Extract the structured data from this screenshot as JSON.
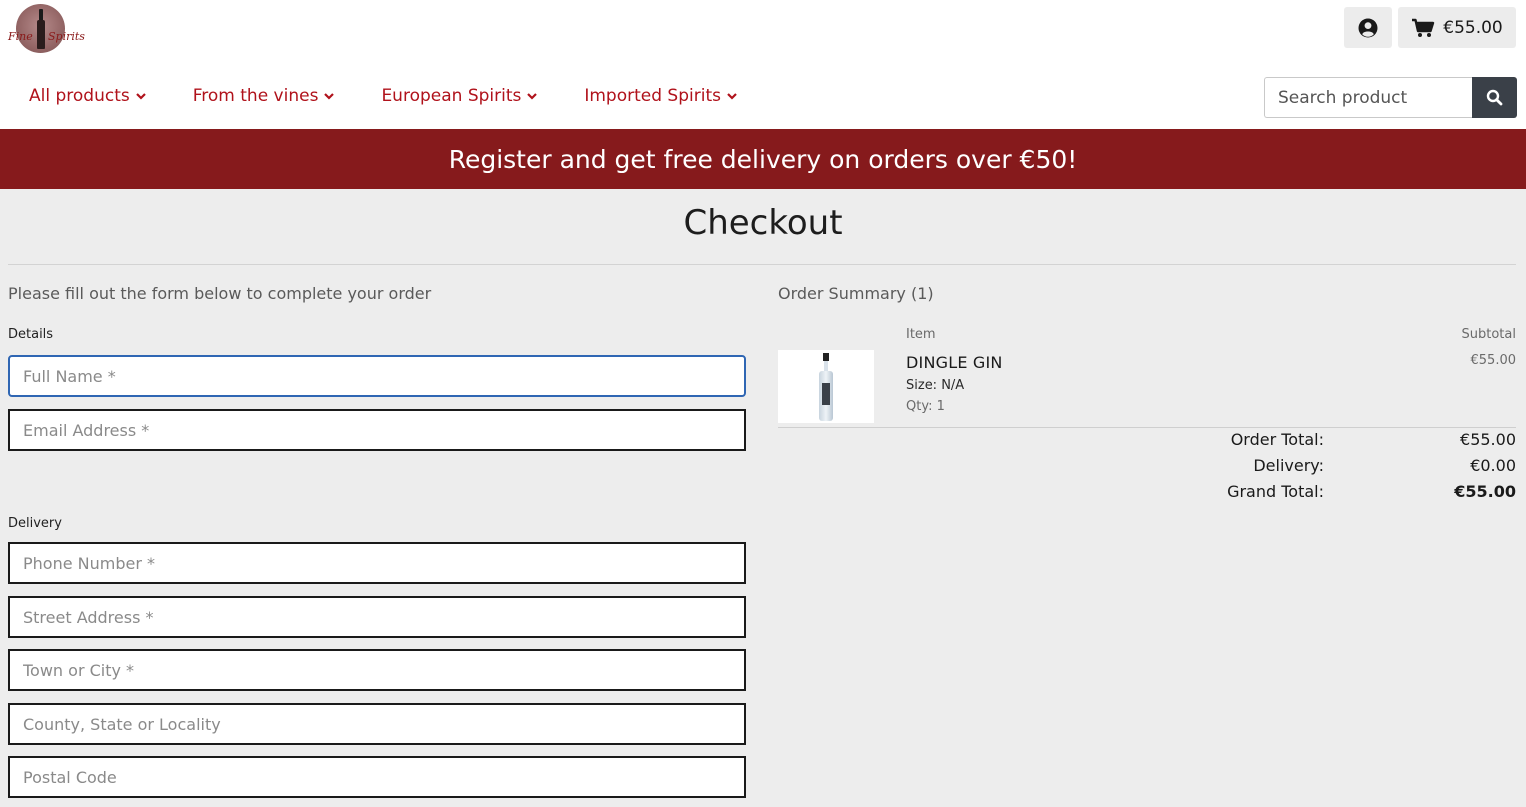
{
  "brand": {
    "logo_word_1": "Fine",
    "logo_word_2": "Spirits"
  },
  "header": {
    "cart_total": "€55.00",
    "account_icon": "user-circle-icon",
    "cart_icon": "shopping-cart-icon"
  },
  "nav": {
    "items": [
      {
        "label": "All products"
      },
      {
        "label": "From the vines"
      },
      {
        "label": "European Spirits"
      },
      {
        "label": "Imported Spirits"
      }
    ]
  },
  "search": {
    "placeholder": "Search product",
    "icon": "search-icon"
  },
  "banner": {
    "text": "Register and get free delivery on orders over €50!"
  },
  "page": {
    "title": "Checkout"
  },
  "form": {
    "intro": "Please fill out the form below to complete your order",
    "details_label": "Details",
    "delivery_label": "Delivery",
    "fields": {
      "full_name": "Full Name *",
      "email": "Email Address *",
      "phone": "Phone Number *",
      "street": "Street Address *",
      "town": "Town or City *",
      "county": "County, State or Locality",
      "postal": "Postal Code"
    }
  },
  "summary": {
    "title": "Order Summary (1)",
    "col_item": "Item",
    "col_subtotal": "Subtotal",
    "product": {
      "name": "DINGLE GIN",
      "size": "Size: N/A",
      "qty": "Qty: 1",
      "subtotal": "€55.00"
    },
    "totals": {
      "order_total_label": "Order Total:",
      "order_total_value": "€55.00",
      "delivery_label": "Delivery:",
      "delivery_value": "€0.00",
      "grand_total_label": "Grand Total:",
      "grand_total_value": "€55.00"
    }
  },
  "colors": {
    "accent_red": "#b0121b",
    "banner_red": "#861a1c",
    "focus_blue": "#2f66b3",
    "search_button": "#3a4048"
  }
}
